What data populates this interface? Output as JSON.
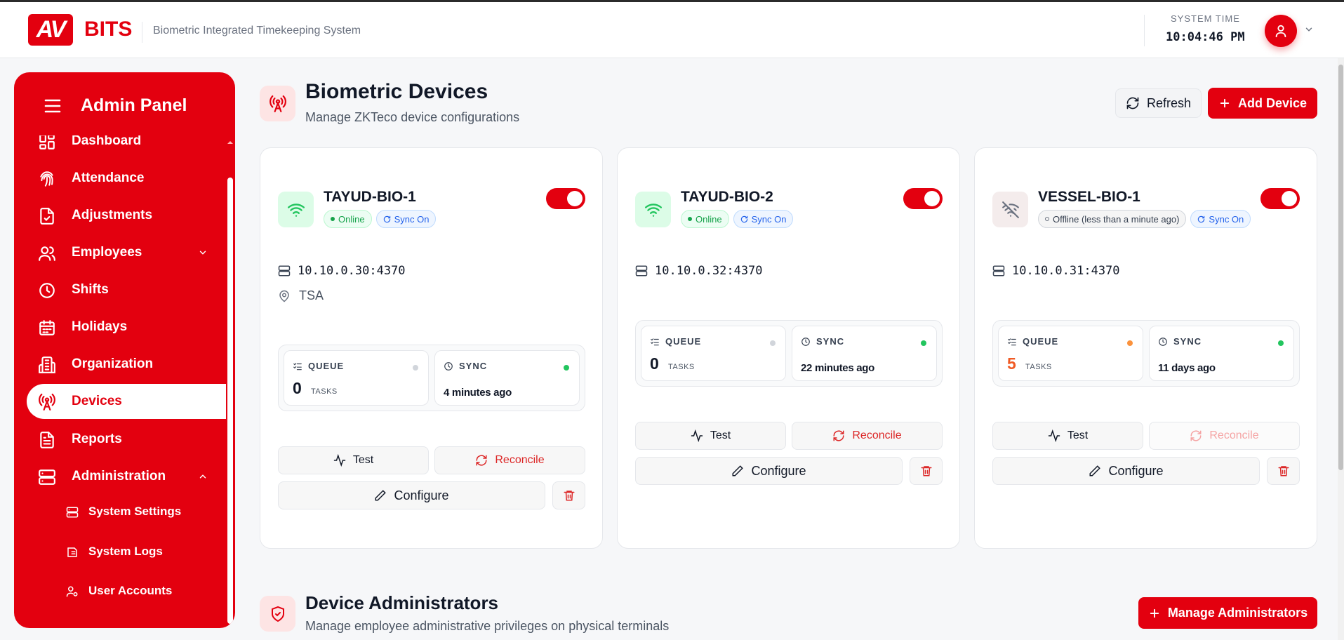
{
  "header": {
    "logo_mark": "AV",
    "logo_word": "BITS",
    "tagline": "Biometric Integrated Timekeeping System",
    "time_label": "SYSTEM TIME",
    "time_value": "10:04:46 PM"
  },
  "sidebar": {
    "title": "Admin Panel",
    "items": [
      {
        "label": "Dashboard",
        "icon": "dashboard-icon"
      },
      {
        "label": "Attendance",
        "icon": "fingerprint-icon"
      },
      {
        "label": "Adjustments",
        "icon": "file-check-icon"
      },
      {
        "label": "Employees",
        "icon": "users-icon"
      },
      {
        "label": "Shifts",
        "icon": "clock-icon"
      },
      {
        "label": "Holidays",
        "icon": "calendar-icon"
      },
      {
        "label": "Organization",
        "icon": "building-icon"
      },
      {
        "label": "Devices",
        "icon": "radio-tower-icon"
      },
      {
        "label": "Reports",
        "icon": "file-text-icon"
      },
      {
        "label": "Administration",
        "icon": "server-icon"
      }
    ],
    "subitems": [
      {
        "label": "System Settings",
        "icon": "server-icon"
      },
      {
        "label": "System Logs",
        "icon": "logs-icon"
      },
      {
        "label": "User Accounts",
        "icon": "user-cog-icon"
      }
    ]
  },
  "page": {
    "title": "Biometric Devices",
    "subtitle": "Manage ZKTeco device configurations",
    "refresh_label": "Refresh",
    "add_label": "Add Device"
  },
  "devices": [
    {
      "name": "TAYUD-BIO-1",
      "status": "Online",
      "sync_badge": "Sync On",
      "address": "10.10.0.30:4370",
      "location": "TSA",
      "queue_label": "QUEUE",
      "queue_count": "0",
      "queue_unit": "TASKS",
      "sync_label": "SYNC",
      "sync_time": "4 minutes ago",
      "test_label": "Test",
      "reconcile_label": "Reconcile",
      "configure_label": "Configure"
    },
    {
      "name": "TAYUD-BIO-2",
      "status": "Online",
      "sync_badge": "Sync On",
      "address": "10.10.0.32:4370",
      "location": "",
      "queue_label": "QUEUE",
      "queue_count": "0",
      "queue_unit": "TASKS",
      "sync_label": "SYNC",
      "sync_time": "22 minutes ago",
      "test_label": "Test",
      "reconcile_label": "Reconcile",
      "configure_label": "Configure"
    },
    {
      "name": "VESSEL-BIO-1",
      "status": "Offline (less than a minute ago)",
      "sync_badge": "Sync On",
      "address": "10.10.0.31:4370",
      "location": "",
      "queue_label": "QUEUE",
      "queue_count": "5",
      "queue_unit": "TASKS",
      "sync_label": "SYNC",
      "sync_time": "11 days ago",
      "test_label": "Test",
      "reconcile_label": "Reconcile",
      "configure_label": "Configure"
    }
  ],
  "admins": {
    "title": "Device Administrators",
    "subtitle": "Manage employee administrative privileges on physical terminals",
    "manage_label": "Manage Administrators"
  },
  "colors": {
    "brand": "#e3000f",
    "online": "#16a34a",
    "sync": "#2563eb",
    "queue_warn": "#f05a24"
  }
}
